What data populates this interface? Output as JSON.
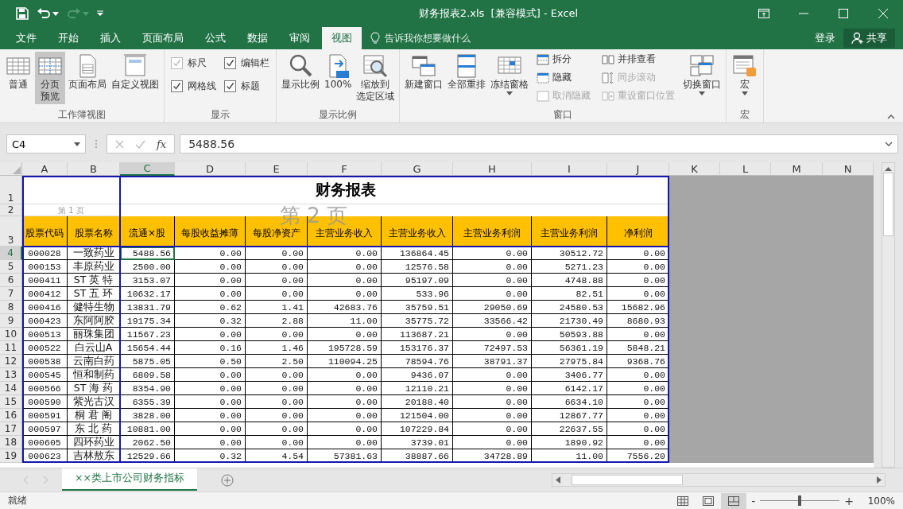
{
  "title_bar": {
    "title": "财务报表2.xls  [兼容模式] - Excel"
  },
  "ribbon_tabs": [
    {
      "label": "文件",
      "selected": false
    },
    {
      "label": "开始",
      "selected": false
    },
    {
      "label": "插入",
      "selected": false
    },
    {
      "label": "页面布局",
      "selected": false
    },
    {
      "label": "公式",
      "selected": false
    },
    {
      "label": "数据",
      "selected": false
    },
    {
      "label": "审阅",
      "selected": false
    },
    {
      "label": "视图",
      "selected": true
    }
  ],
  "tell_me": {
    "placeholder": "告诉我你想要做什么"
  },
  "account": {
    "sign_in": "登录",
    "share": "共享"
  },
  "ribbon_groups": [
    {
      "label": "工作簿视图",
      "items": [
        {
          "kind": "large",
          "label": "普通",
          "selected": false
        },
        {
          "kind": "large",
          "label": [
            "分页",
            "预览"
          ],
          "selected": true
        },
        {
          "kind": "large",
          "label": "页面布局",
          "selected": false
        },
        {
          "kind": "large",
          "label": "自定义视图",
          "selected": false
        }
      ]
    },
    {
      "label": "显示",
      "items": [
        {
          "kind": "check",
          "label": "标尺",
          "checked": true,
          "disabled": true
        },
        {
          "kind": "check",
          "label": "网格线",
          "checked": true,
          "disabled": false
        },
        {
          "kind": "check",
          "label": "编辑栏",
          "checked": true,
          "disabled": false
        },
        {
          "kind": "check",
          "label": "标题",
          "checked": true,
          "disabled": false
        }
      ]
    },
    {
      "label": "显示比例",
      "items": [
        {
          "kind": "large",
          "label": "显示比例"
        },
        {
          "kind": "large",
          "label": "100%"
        },
        {
          "kind": "large",
          "label": [
            "缩放到",
            "选定区域"
          ]
        }
      ]
    },
    {
      "label": "窗口",
      "items": [
        {
          "kind": "large",
          "label": "新建窗口"
        },
        {
          "kind": "large",
          "label": "全部重排"
        },
        {
          "kind": "menu",
          "label": "冻结窗格"
        },
        {
          "kind": "small",
          "label": "拆分",
          "disabled": false
        },
        {
          "kind": "small",
          "label": "隐藏",
          "disabled": false
        },
        {
          "kind": "small",
          "label": "取消隐藏",
          "disabled": true
        },
        {
          "kind": "small",
          "label": "并排查看",
          "disabled": false
        },
        {
          "kind": "small",
          "label": "同步滚动",
          "disabled": true
        },
        {
          "kind": "small",
          "label": "重设窗口位置",
          "disabled": true
        },
        {
          "kind": "menu",
          "label": "切换窗口"
        }
      ]
    },
    {
      "label": "宏",
      "items": [
        {
          "kind": "menu",
          "label": "宏"
        }
      ]
    }
  ],
  "formula_bar": {
    "name_box": "C4",
    "function_button": "fx",
    "value": "5488.56"
  },
  "sheet": {
    "columns": [
      {
        "label": "A",
        "selected": false
      },
      {
        "label": "B",
        "selected": false
      },
      {
        "label": "C",
        "selected": true
      },
      {
        "label": "D",
        "selected": false
      },
      {
        "label": "E",
        "selected": false
      },
      {
        "label": "F",
        "selected": false
      },
      {
        "label": "G",
        "selected": false
      },
      {
        "label": "H",
        "selected": false
      },
      {
        "label": "I",
        "selected": false
      },
      {
        "label": "J",
        "selected": false
      },
      {
        "label": "K",
        "selected": false
      },
      {
        "label": "L",
        "selected": false
      },
      {
        "label": "M",
        "selected": false
      },
      {
        "label": "N",
        "selected": false
      }
    ],
    "title_row": {
      "num": "1",
      "text": "财务报表"
    },
    "page_row": {
      "num": "2",
      "page_label": "第 1 页"
    },
    "page_overlay": "第 2 页",
    "header_row": {
      "num": "3",
      "cells": [
        "股票代码",
        "股票名称",
        "流通×股",
        "每股收益摊薄",
        "每股净资产",
        "主营业务收入",
        "主营业务收入",
        "主营业务利润",
        "主营业务利润",
        "净利润"
      ]
    },
    "rows": [
      {
        "num": "4",
        "selected": true,
        "cells": [
          "000028",
          "一致药业",
          "5488.56",
          "0.00",
          "0.00",
          "0.00",
          "136864.45",
          "0.00",
          "30512.72",
          "0.00"
        ]
      },
      {
        "num": "5",
        "selected": false,
        "cells": [
          "000153",
          "丰原药业",
          "2500.00",
          "0.00",
          "0.00",
          "0.00",
          "12576.58",
          "0.00",
          "5271.23",
          "0.00"
        ]
      },
      {
        "num": "6",
        "selected": false,
        "cells": [
          "000411",
          "ST 英 特",
          "3153.07",
          "0.00",
          "0.00",
          "0.00",
          "95197.09",
          "0.00",
          "4748.88",
          "0.00"
        ]
      },
      {
        "num": "7",
        "selected": false,
        "cells": [
          "000412",
          "ST 五 环",
          "10632.17",
          "0.00",
          "0.00",
          "0.00",
          "533.96",
          "0.00",
          "82.51",
          "0.00"
        ]
      },
      {
        "num": "8",
        "selected": false,
        "cells": [
          "000416",
          "健特生物",
          "13831.79",
          "0.62",
          "1.41",
          "42683.76",
          "35759.51",
          "29050.69",
          "24580.53",
          "15682.96"
        ]
      },
      {
        "num": "9",
        "selected": false,
        "cells": [
          "000423",
          "东阿阿胶",
          "19175.34",
          "0.32",
          "2.88",
          "11.00",
          "35775.72",
          "33566.42",
          "21730.49",
          "8680.93"
        ]
      },
      {
        "num": "10",
        "selected": false,
        "cells": [
          "000513",
          "丽珠集团",
          "11567.23",
          "0.00",
          "0.00",
          "0.00",
          "113687.21",
          "0.00",
          "50593.88",
          "0.00"
        ]
      },
      {
        "num": "11",
        "selected": false,
        "cells": [
          "000522",
          "白云山A",
          "15654.44",
          "0.16",
          "1.46",
          "195728.59",
          "153176.37",
          "72497.53",
          "56361.19",
          "5848.21"
        ]
      },
      {
        "num": "12",
        "selected": false,
        "cells": [
          "000538",
          "云南白药",
          "5875.05",
          "0.50",
          "2.50",
          "110094.25",
          "78594.76",
          "38791.37",
          "27975.84",
          "9368.76"
        ]
      },
      {
        "num": "13",
        "selected": false,
        "cells": [
          "000545",
          "恒和制药",
          "6809.58",
          "0.00",
          "0.00",
          "0.00",
          "9436.07",
          "0.00",
          "3406.77",
          "0.00"
        ]
      },
      {
        "num": "14",
        "selected": false,
        "cells": [
          "000566",
          "ST 海 药",
          "8354.90",
          "0.00",
          "0.00",
          "0.00",
          "12110.21",
          "0.00",
          "6142.17",
          "0.00"
        ]
      },
      {
        "num": "15",
        "selected": false,
        "cells": [
          "000590",
          "紫光古汉",
          "6355.39",
          "0.00",
          "0.00",
          "0.00",
          "20188.40",
          "0.00",
          "6634.10",
          "0.00"
        ]
      },
      {
        "num": "16",
        "selected": false,
        "cells": [
          "000591",
          "桐 君 阁",
          "3828.00",
          "0.00",
          "0.00",
          "0.00",
          "121504.00",
          "0.00",
          "12867.77",
          "0.00"
        ]
      },
      {
        "num": "17",
        "selected": false,
        "cells": [
          "000597",
          "东 北 药",
          "10881.00",
          "0.00",
          "0.00",
          "0.00",
          "107229.84",
          "0.00",
          "22637.55",
          "0.00"
        ]
      },
      {
        "num": "18",
        "selected": false,
        "cells": [
          "000605",
          "四环药业",
          "2062.50",
          "0.00",
          "0.00",
          "0.00",
          "3739.01",
          "0.00",
          "1890.92",
          "0.00"
        ]
      },
      {
        "num": "19",
        "selected": false,
        "cells": [
          "000623",
          "吉林敖东",
          "12529.66",
          "0.32",
          "4.54",
          "57381.63",
          "38887.66",
          "34728.89",
          "11.00",
          "7556.20"
        ]
      }
    ]
  },
  "sheet_tabs": [
    {
      "label": "××类上市公司财务指标",
      "selected": true
    }
  ],
  "status_bar": {
    "text": "就绪",
    "view_buttons": [
      {
        "selected": false
      },
      {
        "selected": false
      },
      {
        "selected": true
      }
    ],
    "zoom_out": "-",
    "zoom_slider": {
      "level": 0.5
    },
    "zoom_in": "+",
    "zoom": "100%"
  }
}
